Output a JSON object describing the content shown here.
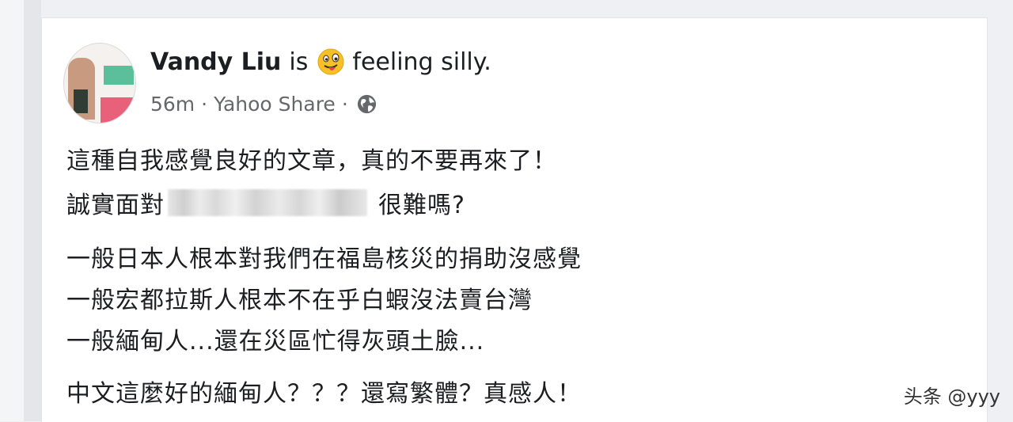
{
  "post": {
    "author": "Vandy Liu",
    "verb": "is",
    "feeling_emoji": "silly-face-emoji",
    "feeling_text": "feeling silly.",
    "time": "56m",
    "separator": "·",
    "source": "Yahoo Share",
    "audience_icon": "globe-icon",
    "lines": [
      "這種自我感覺良好的文章，真的不要再來了！",
      "誠實面對",
      "很難嗎?",
      "一般日本人根本對我們在福島核災的捐助沒感覺",
      "一般宏都拉斯人根本不在乎白蝦沒法賣台灣",
      "一般緬甸人...還在災區忙得灰頭土臉...",
      "中文這麼好的緬甸人？？？還寫繁體？真感人！"
    ]
  },
  "watermark": "头条 @yyy",
  "colors": {
    "text": "#1c1e21",
    "meta": "#65676b",
    "emoji_face": "#f6c026"
  }
}
